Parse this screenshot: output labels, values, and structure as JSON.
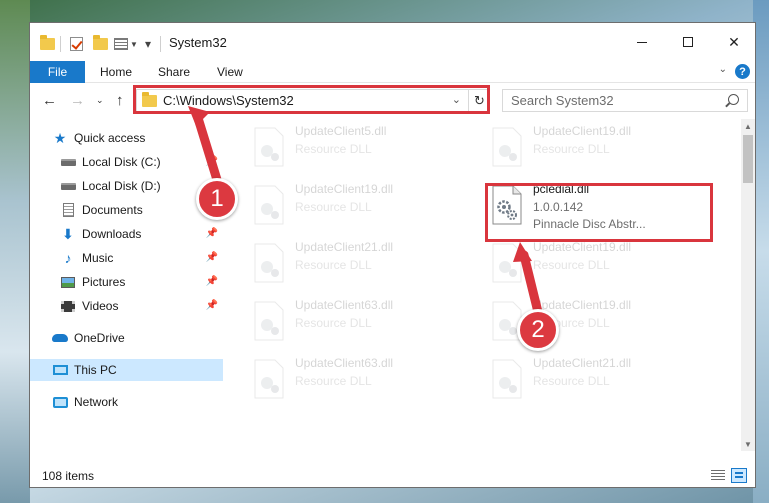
{
  "window": {
    "title": "System32",
    "minimize_label": "—",
    "maximize_label": "",
    "close_label": "✕"
  },
  "ribbon": {
    "tabs": [
      "File",
      "Home",
      "Share",
      "View"
    ],
    "help_label": "?"
  },
  "nav": {
    "address": "C:\\Windows\\System32",
    "search_placeholder": "Search System32"
  },
  "sidebar": {
    "items": [
      {
        "label": "Quick access",
        "icon": "star-icon",
        "pinned": false
      },
      {
        "label": "Local Disk (C:)",
        "icon": "disk-icon",
        "pinned": true
      },
      {
        "label": "Local Disk (D:)",
        "icon": "disk-icon",
        "pinned": true
      },
      {
        "label": "Documents",
        "icon": "document-icon",
        "pinned": true
      },
      {
        "label": "Downloads",
        "icon": "download-icon",
        "pinned": true
      },
      {
        "label": "Music",
        "icon": "music-icon",
        "pinned": true
      },
      {
        "label": "Pictures",
        "icon": "pictures-icon",
        "pinned": true
      },
      {
        "label": "Videos",
        "icon": "videos-icon",
        "pinned": true
      },
      {
        "label": "OneDrive",
        "icon": "onedrive-icon",
        "pinned": false
      },
      {
        "label": "This PC",
        "icon": "this-pc-icon",
        "pinned": false,
        "selected": true
      },
      {
        "label": "Network",
        "icon": "network-icon",
        "pinned": false
      }
    ]
  },
  "files": [
    {
      "name": "UpdateClient5.dll",
      "version": "",
      "desc": "Resource DLL",
      "faded": true
    },
    {
      "name": "UpdateClient19.dll",
      "version": "",
      "desc": "Resource DLL",
      "faded": true
    },
    {
      "name": "UpdateClient19.dll",
      "version": "",
      "desc": "Resource DLL",
      "faded": true
    },
    {
      "name": "pcledial.dll",
      "version": "1.0.0.142",
      "desc": "Pinnacle Disc Abstr...",
      "faded": false
    },
    {
      "name": "UpdateClient21.dll",
      "version": "",
      "desc": "Resource DLL",
      "faded": true
    },
    {
      "name": "UpdateClient19.dll",
      "version": "",
      "desc": "Resource DLL",
      "faded": true
    },
    {
      "name": "UpdateClient63.dll",
      "version": "",
      "desc": "Resource DLL",
      "faded": true
    },
    {
      "name": "UpdateClient19.dll",
      "version": "",
      "desc": "Resource DLL",
      "faded": true
    },
    {
      "name": "UpdateClient63.dll",
      "version": "",
      "desc": "Resource DLL",
      "faded": true
    },
    {
      "name": "UpdateClient21.dll",
      "version": "",
      "desc": "Resource DLL",
      "faded": true
    }
  ],
  "status": {
    "item_count": "108 items"
  },
  "annotations": {
    "step1": "1",
    "step2": "2"
  },
  "colors": {
    "accent": "#1979ca",
    "highlight": "#d9353d",
    "selection": "#cce8ff"
  }
}
